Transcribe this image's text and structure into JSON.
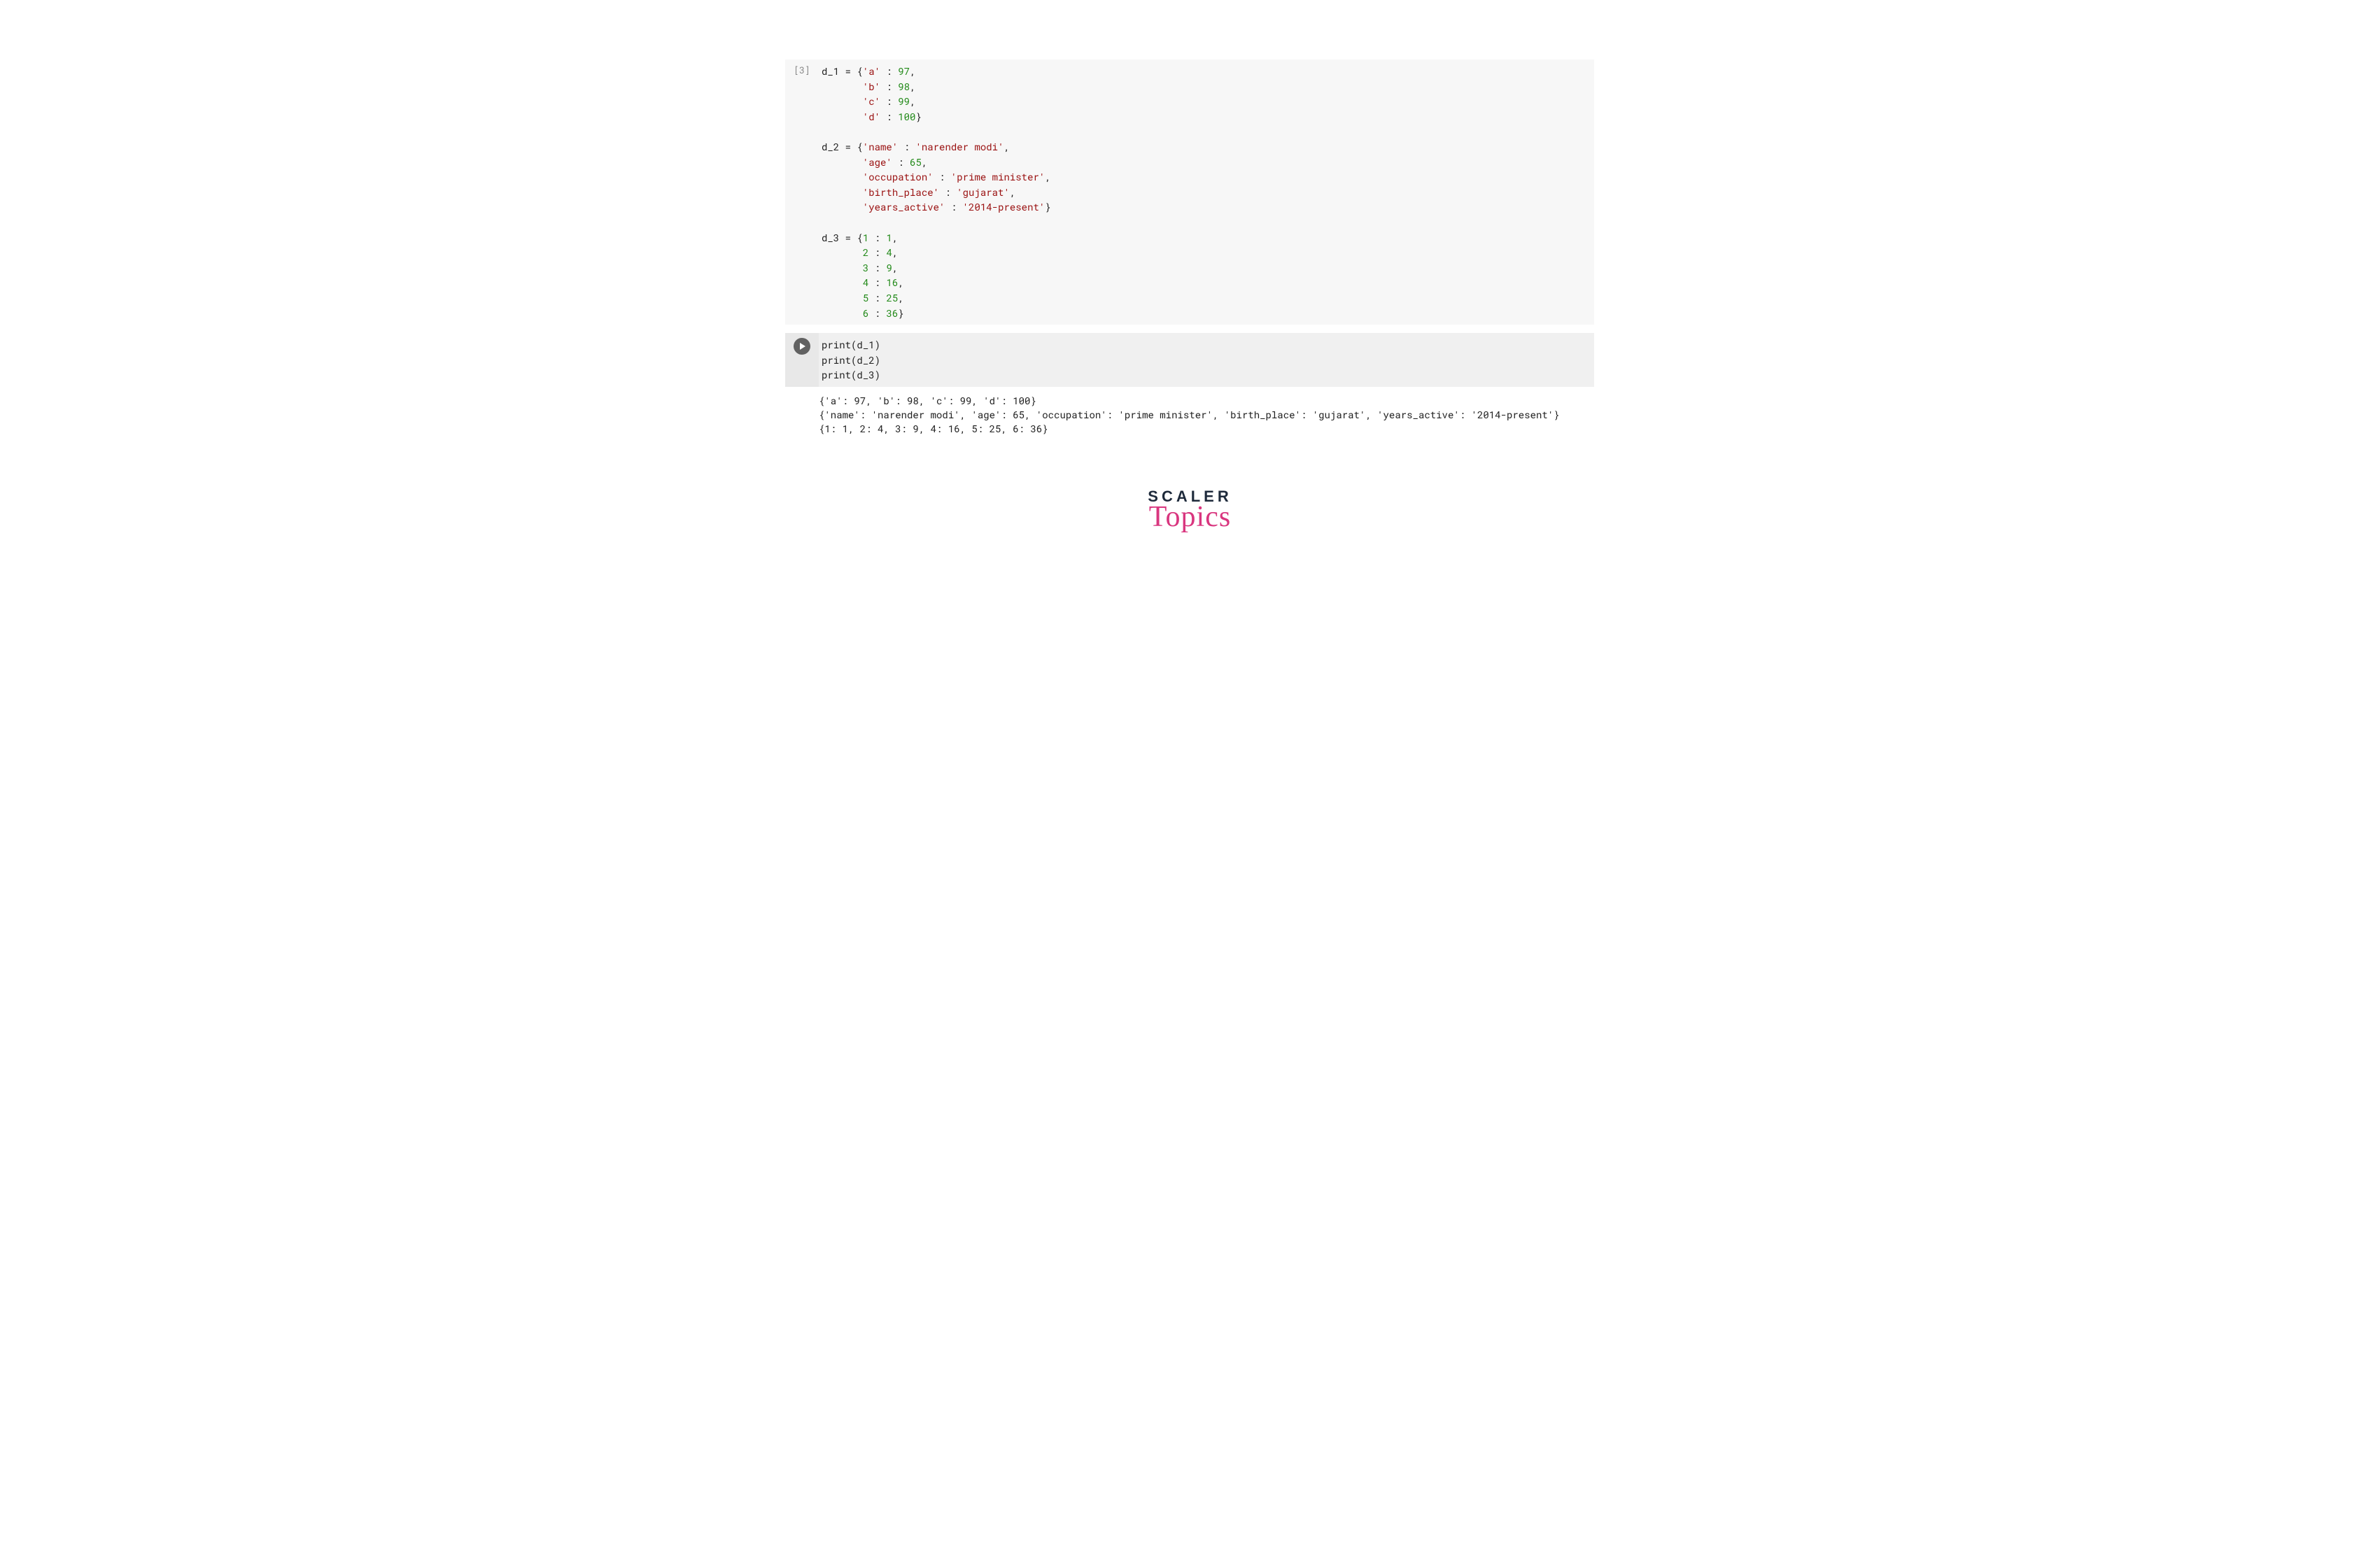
{
  "cell1": {
    "exec_count": "[3]",
    "tokens": [
      {
        "t": "d_1 = {"
      },
      {
        "t": "'a'",
        "c": "str"
      },
      {
        "t": " : "
      },
      {
        "t": "97",
        "c": "num"
      },
      {
        "t": ",\n"
      },
      {
        "t": "       "
      },
      {
        "t": "'b'",
        "c": "str"
      },
      {
        "t": " : "
      },
      {
        "t": "98",
        "c": "num"
      },
      {
        "t": ",\n"
      },
      {
        "t": "       "
      },
      {
        "t": "'c'",
        "c": "str"
      },
      {
        "t": " : "
      },
      {
        "t": "99",
        "c": "num"
      },
      {
        "t": ",\n"
      },
      {
        "t": "       "
      },
      {
        "t": "'d'",
        "c": "str"
      },
      {
        "t": " : "
      },
      {
        "t": "100",
        "c": "num"
      },
      {
        "t": "}\n\n"
      },
      {
        "t": "d_2 = {"
      },
      {
        "t": "'name'",
        "c": "str"
      },
      {
        "t": " : "
      },
      {
        "t": "'narender modi'",
        "c": "str"
      },
      {
        "t": ",\n"
      },
      {
        "t": "       "
      },
      {
        "t": "'age'",
        "c": "str"
      },
      {
        "t": " : "
      },
      {
        "t": "65",
        "c": "num"
      },
      {
        "t": ",\n"
      },
      {
        "t": "       "
      },
      {
        "t": "'occupation'",
        "c": "str"
      },
      {
        "t": " : "
      },
      {
        "t": "'prime minister'",
        "c": "str"
      },
      {
        "t": ",\n"
      },
      {
        "t": "       "
      },
      {
        "t": "'birth_place'",
        "c": "str"
      },
      {
        "t": " : "
      },
      {
        "t": "'gujarat'",
        "c": "str"
      },
      {
        "t": ",\n"
      },
      {
        "t": "       "
      },
      {
        "t": "'years_active'",
        "c": "str"
      },
      {
        "t": " : "
      },
      {
        "t": "'2014-present'",
        "c": "str"
      },
      {
        "t": "}\n\n"
      },
      {
        "t": "d_3 = {"
      },
      {
        "t": "1",
        "c": "num"
      },
      {
        "t": " : "
      },
      {
        "t": "1",
        "c": "num"
      },
      {
        "t": ",\n"
      },
      {
        "t": "       "
      },
      {
        "t": "2",
        "c": "num"
      },
      {
        "t": " : "
      },
      {
        "t": "4",
        "c": "num"
      },
      {
        "t": ",\n"
      },
      {
        "t": "       "
      },
      {
        "t": "3",
        "c": "num"
      },
      {
        "t": " : "
      },
      {
        "t": "9",
        "c": "num"
      },
      {
        "t": ",\n"
      },
      {
        "t": "       "
      },
      {
        "t": "4",
        "c": "num"
      },
      {
        "t": " : "
      },
      {
        "t": "16",
        "c": "num"
      },
      {
        "t": ",\n"
      },
      {
        "t": "       "
      },
      {
        "t": "5",
        "c": "num"
      },
      {
        "t": " : "
      },
      {
        "t": "25",
        "c": "num"
      },
      {
        "t": ",\n"
      },
      {
        "t": "       "
      },
      {
        "t": "6",
        "c": "num"
      },
      {
        "t": " : "
      },
      {
        "t": "36",
        "c": "num"
      },
      {
        "t": "}"
      }
    ]
  },
  "cell2": {
    "tokens": [
      {
        "t": "print",
        "c": ""
      },
      {
        "t": "(d_1)\n"
      },
      {
        "t": "print",
        "c": ""
      },
      {
        "t": "(d_2)\n"
      },
      {
        "t": "print",
        "c": ""
      },
      {
        "t": "(d_3)"
      }
    ]
  },
  "output": {
    "lines": [
      "{'a': 97, 'b': 98, 'c': 99, 'd': 100}",
      "{'name': 'narender modi', 'age': 65, 'occupation': 'prime minister', 'birth_place': 'gujarat', 'years_active': '2014-present'}",
      "{1: 1, 2: 4, 3: 9, 4: 16, 5: 25, 6: 36}"
    ]
  },
  "logo": {
    "line1": "SCALER",
    "line2": "Topics"
  }
}
